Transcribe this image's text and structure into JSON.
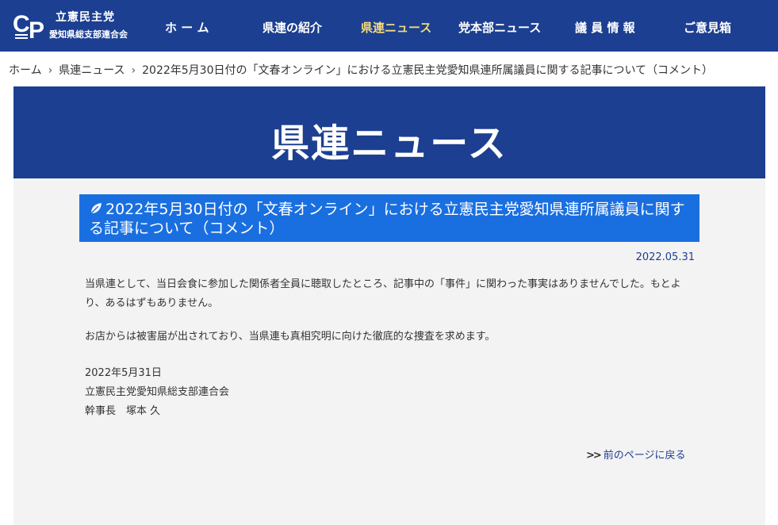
{
  "header": {
    "logo_line1": "立憲民主党",
    "logo_line2": "愛知県総支部連合会",
    "nav": [
      {
        "label": "ホ ー ム"
      },
      {
        "label": "県連の紹介"
      },
      {
        "label": "県連ニュース"
      },
      {
        "label": "党本部ニュース"
      },
      {
        "label": "議 員 情 報"
      },
      {
        "label": "ご意見箱"
      }
    ]
  },
  "breadcrumb": {
    "home": "ホーム",
    "section": "県連ニュース",
    "current": "2022年5月30日付の「文春オンライン」における立憲民主党愛知県連所属議員に関する記事について（コメント）",
    "separator": "›"
  },
  "banner": {
    "title": "県連ニュース"
  },
  "article": {
    "title": "2022年5月30日付の「文春オンライン」における立憲民主党愛知県連所属議員に関する記事について（コメント）",
    "date": "2022.05.31",
    "paragraph1": "当県連として、当日会食に参加した関係者全員に聴取したところ、記事中の「事件」に関わった事実はありませんでした。もとより、あるはずもありません。",
    "paragraph2": "お店からは被害届が出されており、当県連も真相究明に向けた徹底的な捜査を求めます。",
    "signature_date": "2022年5月31日",
    "signature_org": "立憲民主党愛知県総支部連合会",
    "signature_name": "幹事長　塚本 久"
  },
  "back_link": {
    "label": "前のページに戻る"
  },
  "colors": {
    "header_bg": "#1c3f91",
    "nav_active": "#f3d97b",
    "heading_bg": "#1a6fe0",
    "content_bg": "#f3f3f3"
  }
}
